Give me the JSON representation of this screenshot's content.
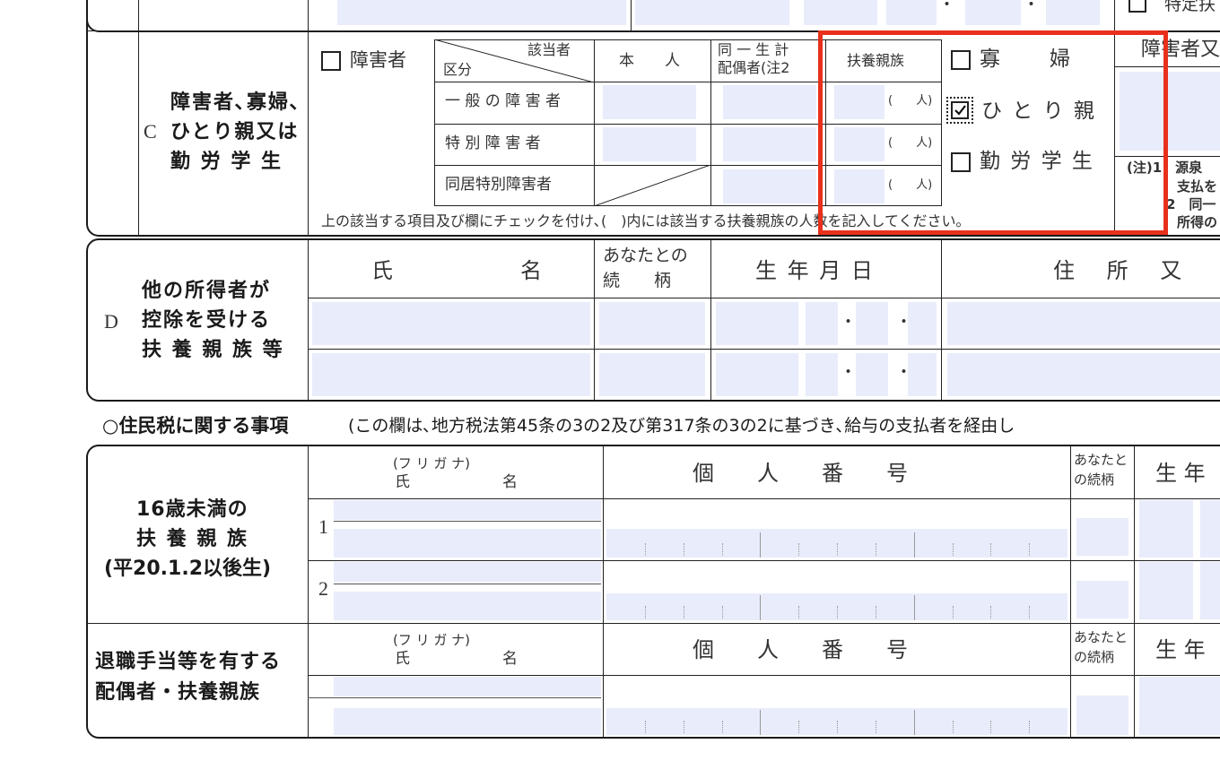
{
  "sectionC": {
    "letter": "C",
    "title_lines": [
      "障害者､寡婦､",
      "ひとり親又は",
      "勤 労 学 生"
    ],
    "disabled_checkbox_label": "障害者",
    "header_applicant": "該当者",
    "header_category": "区分",
    "col_self": "本　　人",
    "col_spouse_line1": "同 一 生 計",
    "col_spouse_line2": "配偶者(注2",
    "col_dependents": "扶養親族",
    "rows": [
      "一 般 の 障 害 者",
      "特 別 障 害 者",
      "同居特別障害者"
    ],
    "person_unit": "(　　人)",
    "widow_label": "寡　　婦",
    "single_parent_label": "ひ と り 親",
    "single_parent_checked": true,
    "working_student_label": "勤 労 学 生",
    "right_header": "障害者又",
    "note_lines": [
      "(注)1　源泉",
      "支払を",
      "2　同一",
      "所得の"
    ],
    "instruction": "上の該当する項目及び欄にチェックを付け､(　)内には該当する扶養親族の人数を記入してください｡",
    "top_right_label": "特定扶"
  },
  "sectionD": {
    "letter": "D",
    "title_lines": [
      "他の所得者が",
      "控除を受ける",
      "扶 養 親 族 等"
    ],
    "col_name_1": "氏",
    "col_name_2": "名",
    "col_relation_1": "あなたとの",
    "col_relation_2": "続　　柄",
    "col_birth": "生 年 月 日",
    "col_address": "住 所 又",
    "dot": "・"
  },
  "residentTax": {
    "heading": "○住民税に関する事項",
    "subheading": "(この欄は､地方税法第45条の3の2及び第317条の3の2に基づき､給与の支払者を経由し"
  },
  "under16": {
    "title_lines": [
      "16歳未満の",
      "扶 養 親 族",
      "(平20.1.2以後生)"
    ],
    "furigana": "(フ リ ガ ナ)",
    "name_1": "氏",
    "name_2": "名",
    "col_mynumber": "個　　人　　番　　号",
    "col_relation_1": "あなたと",
    "col_relation_2": "の続柄",
    "col_birth": "生 年",
    "rows": [
      "1",
      "2"
    ]
  },
  "retirement": {
    "title_lines": [
      "退職手当等を有する",
      "配偶者・扶養親族"
    ],
    "furigana": "(フ リ ガ ナ)",
    "name_1": "氏",
    "name_2": "名",
    "col_mynumber": "個　　人　　番　　号",
    "col_relation_1": "あなたと",
    "col_relation_2": "の続柄",
    "col_birth": "生 年"
  },
  "highlight_color": "#e8301c",
  "field_fill_color": "#e8ecfb"
}
